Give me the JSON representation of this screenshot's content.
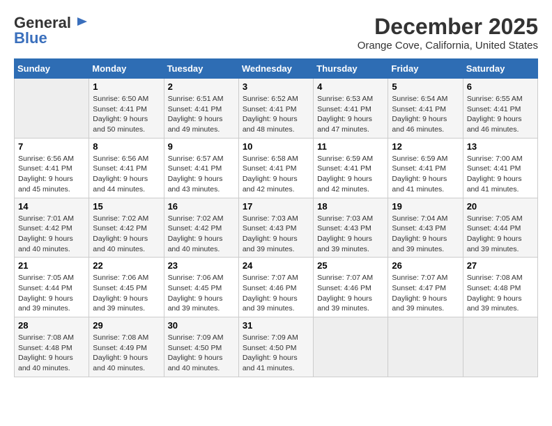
{
  "header": {
    "logo": {
      "general": "General",
      "blue": "Blue"
    },
    "month": "December 2025",
    "location": "Orange Cove, California, United States"
  },
  "weekdays": [
    "Sunday",
    "Monday",
    "Tuesday",
    "Wednesday",
    "Thursday",
    "Friday",
    "Saturday"
  ],
  "weeks": [
    [
      {
        "day": "",
        "empty": true
      },
      {
        "day": "1",
        "sunrise": "Sunrise: 6:50 AM",
        "sunset": "Sunset: 4:41 PM",
        "daylight": "Daylight: 9 hours and 50 minutes."
      },
      {
        "day": "2",
        "sunrise": "Sunrise: 6:51 AM",
        "sunset": "Sunset: 4:41 PM",
        "daylight": "Daylight: 9 hours and 49 minutes."
      },
      {
        "day": "3",
        "sunrise": "Sunrise: 6:52 AM",
        "sunset": "Sunset: 4:41 PM",
        "daylight": "Daylight: 9 hours and 48 minutes."
      },
      {
        "day": "4",
        "sunrise": "Sunrise: 6:53 AM",
        "sunset": "Sunset: 4:41 PM",
        "daylight": "Daylight: 9 hours and 47 minutes."
      },
      {
        "day": "5",
        "sunrise": "Sunrise: 6:54 AM",
        "sunset": "Sunset: 4:41 PM",
        "daylight": "Daylight: 9 hours and 46 minutes."
      },
      {
        "day": "6",
        "sunrise": "Sunrise: 6:55 AM",
        "sunset": "Sunset: 4:41 PM",
        "daylight": "Daylight: 9 hours and 46 minutes."
      }
    ],
    [
      {
        "day": "7",
        "sunrise": "Sunrise: 6:56 AM",
        "sunset": "Sunset: 4:41 PM",
        "daylight": "Daylight: 9 hours and 45 minutes."
      },
      {
        "day": "8",
        "sunrise": "Sunrise: 6:56 AM",
        "sunset": "Sunset: 4:41 PM",
        "daylight": "Daylight: 9 hours and 44 minutes."
      },
      {
        "day": "9",
        "sunrise": "Sunrise: 6:57 AM",
        "sunset": "Sunset: 4:41 PM",
        "daylight": "Daylight: 9 hours and 43 minutes."
      },
      {
        "day": "10",
        "sunrise": "Sunrise: 6:58 AM",
        "sunset": "Sunset: 4:41 PM",
        "daylight": "Daylight: 9 hours and 42 minutes."
      },
      {
        "day": "11",
        "sunrise": "Sunrise: 6:59 AM",
        "sunset": "Sunset: 4:41 PM",
        "daylight": "Daylight: 9 hours and 42 minutes."
      },
      {
        "day": "12",
        "sunrise": "Sunrise: 6:59 AM",
        "sunset": "Sunset: 4:41 PM",
        "daylight": "Daylight: 9 hours and 41 minutes."
      },
      {
        "day": "13",
        "sunrise": "Sunrise: 7:00 AM",
        "sunset": "Sunset: 4:41 PM",
        "daylight": "Daylight: 9 hours and 41 minutes."
      }
    ],
    [
      {
        "day": "14",
        "sunrise": "Sunrise: 7:01 AM",
        "sunset": "Sunset: 4:42 PM",
        "daylight": "Daylight: 9 hours and 40 minutes."
      },
      {
        "day": "15",
        "sunrise": "Sunrise: 7:02 AM",
        "sunset": "Sunset: 4:42 PM",
        "daylight": "Daylight: 9 hours and 40 minutes."
      },
      {
        "day": "16",
        "sunrise": "Sunrise: 7:02 AM",
        "sunset": "Sunset: 4:42 PM",
        "daylight": "Daylight: 9 hours and 40 minutes."
      },
      {
        "day": "17",
        "sunrise": "Sunrise: 7:03 AM",
        "sunset": "Sunset: 4:43 PM",
        "daylight": "Daylight: 9 hours and 39 minutes."
      },
      {
        "day": "18",
        "sunrise": "Sunrise: 7:03 AM",
        "sunset": "Sunset: 4:43 PM",
        "daylight": "Daylight: 9 hours and 39 minutes."
      },
      {
        "day": "19",
        "sunrise": "Sunrise: 7:04 AM",
        "sunset": "Sunset: 4:43 PM",
        "daylight": "Daylight: 9 hours and 39 minutes."
      },
      {
        "day": "20",
        "sunrise": "Sunrise: 7:05 AM",
        "sunset": "Sunset: 4:44 PM",
        "daylight": "Daylight: 9 hours and 39 minutes."
      }
    ],
    [
      {
        "day": "21",
        "sunrise": "Sunrise: 7:05 AM",
        "sunset": "Sunset: 4:44 PM",
        "daylight": "Daylight: 9 hours and 39 minutes."
      },
      {
        "day": "22",
        "sunrise": "Sunrise: 7:06 AM",
        "sunset": "Sunset: 4:45 PM",
        "daylight": "Daylight: 9 hours and 39 minutes."
      },
      {
        "day": "23",
        "sunrise": "Sunrise: 7:06 AM",
        "sunset": "Sunset: 4:45 PM",
        "daylight": "Daylight: 9 hours and 39 minutes."
      },
      {
        "day": "24",
        "sunrise": "Sunrise: 7:07 AM",
        "sunset": "Sunset: 4:46 PM",
        "daylight": "Daylight: 9 hours and 39 minutes."
      },
      {
        "day": "25",
        "sunrise": "Sunrise: 7:07 AM",
        "sunset": "Sunset: 4:46 PM",
        "daylight": "Daylight: 9 hours and 39 minutes."
      },
      {
        "day": "26",
        "sunrise": "Sunrise: 7:07 AM",
        "sunset": "Sunset: 4:47 PM",
        "daylight": "Daylight: 9 hours and 39 minutes."
      },
      {
        "day": "27",
        "sunrise": "Sunrise: 7:08 AM",
        "sunset": "Sunset: 4:48 PM",
        "daylight": "Daylight: 9 hours and 39 minutes."
      }
    ],
    [
      {
        "day": "28",
        "sunrise": "Sunrise: 7:08 AM",
        "sunset": "Sunset: 4:48 PM",
        "daylight": "Daylight: 9 hours and 40 minutes."
      },
      {
        "day": "29",
        "sunrise": "Sunrise: 7:08 AM",
        "sunset": "Sunset: 4:49 PM",
        "daylight": "Daylight: 9 hours and 40 minutes."
      },
      {
        "day": "30",
        "sunrise": "Sunrise: 7:09 AM",
        "sunset": "Sunset: 4:50 PM",
        "daylight": "Daylight: 9 hours and 40 minutes."
      },
      {
        "day": "31",
        "sunrise": "Sunrise: 7:09 AM",
        "sunset": "Sunset: 4:50 PM",
        "daylight": "Daylight: 9 hours and 41 minutes."
      },
      {
        "day": "",
        "empty": true
      },
      {
        "day": "",
        "empty": true
      },
      {
        "day": "",
        "empty": true
      }
    ]
  ]
}
